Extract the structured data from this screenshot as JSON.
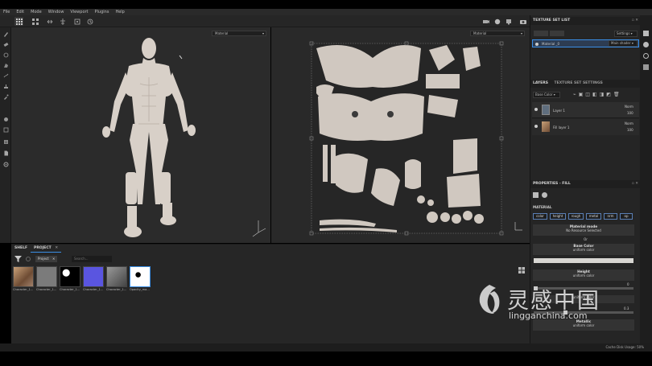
{
  "menu": [
    "File",
    "Edit",
    "Mode",
    "Window",
    "Viewport",
    "Plugins",
    "Help"
  ],
  "viewport3d": {
    "material_select": "Material"
  },
  "viewport2d": {
    "material_select": "Material"
  },
  "texture_set_list": {
    "title": "TEXTURE SET LIST",
    "settings_label": "Settings",
    "item_name": "Material _0",
    "shader": "Main shader"
  },
  "layers": {
    "tab_layers": "LAYERS",
    "tab_texture_settings": "TEXTURE SET SETTINGS",
    "channel_select": "Base Color",
    "items": [
      {
        "name": "Layer 1",
        "blend": "Norm",
        "opacity": "100"
      },
      {
        "name": "Fill layer 1",
        "blend": "Norm",
        "opacity": "100"
      }
    ]
  },
  "properties": {
    "title": "PROPERTIES - FILL",
    "section": "MATERIAL",
    "channels": [
      "color",
      "height",
      "rough",
      "metal",
      "nrm",
      "op"
    ],
    "material_mode_title": "Material mode",
    "material_mode_sub": "No Resource Selected",
    "or_label": "Or",
    "base_color_title": "Base Color",
    "base_color_sub": "uniform color",
    "height_title": "Height",
    "height_sub": "uniform color",
    "height_value": "0",
    "rough_sub": "uniform color",
    "rough_value": "0.3",
    "metallic_title": "Metallic",
    "metallic_sub": "uniform color"
  },
  "shelf": {
    "tab_shelf": "SHELF",
    "tab_project": "PROJECT",
    "chip": "Project",
    "search_placeholder": "Search...",
    "thumbs": [
      {
        "label": "Character_1...",
        "color": "#8a6a4e"
      },
      {
        "label": "Character_1...",
        "color": "#7b7b7b"
      },
      {
        "label": "Character_1...",
        "color": "#000000"
      },
      {
        "label": "Character_1...",
        "color": "#5a55e0"
      },
      {
        "label": "Character_1...",
        "color": "#6c6c6c"
      },
      {
        "label": "Opacity_ma...",
        "color": "#ffffff"
      }
    ]
  },
  "status": {
    "cache": "Cache Disk Usage:",
    "cache_value": "50%"
  },
  "watermark": {
    "cn": "灵感中国",
    "url": "lingganchina.com"
  },
  "colors": {
    "accent": "#3a8ee6",
    "skin": "#d8d0c8"
  }
}
